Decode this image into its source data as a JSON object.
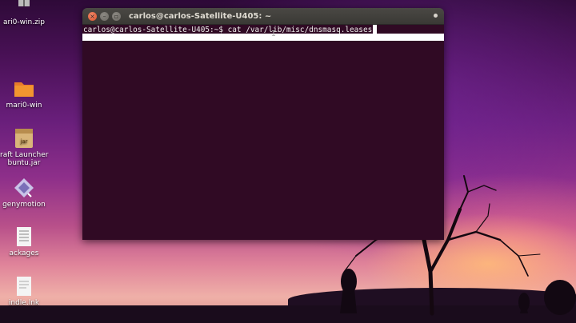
{
  "desktop": {
    "icons": [
      {
        "label": "ari0-win.zip",
        "icon": "zip-archive-icon"
      },
      {
        "label": "mari0-win",
        "icon": "folder-icon"
      },
      {
        "label": "raft Launcher",
        "label2": "buntu.jar",
        "icon": "jar-file-icon",
        "badge": "jar"
      },
      {
        "label": "genymotion",
        "icon": "genymotion-icon"
      },
      {
        "label": "ackages",
        "icon": "text-file-icon"
      },
      {
        "label": "indle.lnk",
        "icon": "document-icon"
      }
    ]
  },
  "terminal": {
    "title": "carlos@carlos-Satellite-U405: ~",
    "prompt": "carlos@carlos-Satellite-U405:~$ ",
    "command": "cat /var/lib/misc/dnsmasq.leases",
    "background": "#300a24",
    "text_color": "#eeeeec"
  },
  "colors": {
    "close_button": "#e0562f",
    "titlebar": "#3c3b37"
  }
}
